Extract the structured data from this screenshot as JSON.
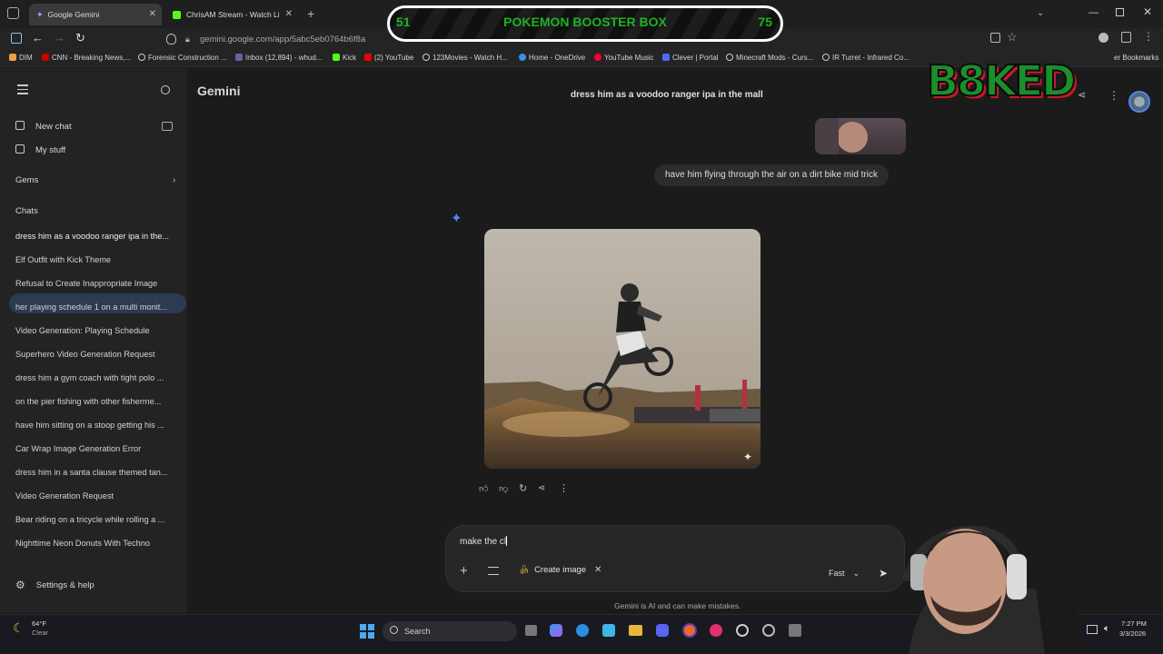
{
  "browser": {
    "tabs": [
      {
        "title": "Google Gemini",
        "active": true
      },
      {
        "title": "ChrisAM Stream - Watch Li"
      }
    ],
    "url": "gemini.google.com/app/5abc5eb0764b6f8a",
    "bookmarks": [
      "DIM",
      "CNN - Breaking News,...",
      "Forensic Construction ...",
      "Inbox (12,894) - whud...",
      "Kick",
      "(2) YouTube",
      "123Movies - Watch H...",
      "Home - OneDrive",
      "YouTube Music",
      "Clever | Portal",
      "Minecraft Mods - Curs...",
      "IR Turret - Infrared Co..."
    ],
    "other_bookmarks": "er Bookmarks"
  },
  "overlay": {
    "left_num": "51",
    "title": "POKEMON BOOSTER BOX",
    "right_num": "75",
    "brand": "B8KED"
  },
  "sidebar": {
    "new_chat": "New chat",
    "my_stuff": "My stuff",
    "gems": "Gems",
    "chats_header": "Chats",
    "chats": [
      "dress him as a voodoo ranger ipa in the...",
      "Elf Outfit with Kick Theme",
      "Refusal to Create Inappropriate Image",
      "her playing schedule 1 on a multi monit...",
      "Video Generation: Playing Schedule",
      "Superhero Video Generation Request",
      "dress him a gym coach with tight polo ...",
      "on the pier fishing with other fisherme...",
      "have him sitting on a stoop getting his ...",
      "Car Wrap Image Generation Error",
      "dress him in a santa clause themed tan...",
      "Video Generation Request",
      "Bear riding on a tricycle while rolling a ...",
      "Nighttime Neon Donuts With Techno"
    ],
    "settings": "Settings & help"
  },
  "main": {
    "app_title": "Gemini",
    "conversation_title": "dress him as a voodoo ranger ipa in the mall",
    "user_prompt": "have him flying through the air on a dirt bike mid trick",
    "composer": {
      "value": "make the cl",
      "create_image": "Create image",
      "mode": "Fast"
    },
    "disclaimer": "Gemini is AI and can make mistakes."
  },
  "taskbar": {
    "weather_temp": "64°F",
    "weather_desc": "Clear",
    "search": "Search",
    "time": "7:27 PM",
    "date": "3/3/2026"
  },
  "colors": {
    "accent": "#4e86f7",
    "active_chat_bg": "#2c3a52",
    "overlay_green": "#1db321"
  }
}
